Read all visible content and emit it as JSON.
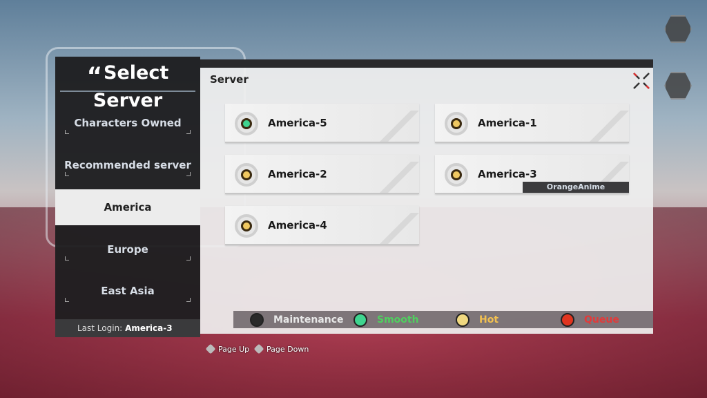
{
  "sidebar": {
    "title": "Select Server",
    "quote": "“",
    "items": [
      {
        "label": "Characters Owned"
      },
      {
        "label": "Recommended server"
      },
      {
        "label": "America",
        "selected": true
      },
      {
        "label": "Europe"
      },
      {
        "label": "East Asia"
      }
    ],
    "last_login_label": "Last Login:",
    "last_login_value": "America-3"
  },
  "main": {
    "header": "Server",
    "servers": [
      {
        "name": "America-5",
        "status": "Smooth",
        "color": "#3fd48f"
      },
      {
        "name": "America-1",
        "status": "Hot",
        "color": "#f0c860"
      },
      {
        "name": "America-2",
        "status": "Hot",
        "color": "#f0c860"
      },
      {
        "name": "America-3",
        "status": "Hot",
        "color": "#f0c860",
        "tag": "OrangeAnime"
      },
      {
        "name": "America-4",
        "status": "Hot",
        "color": "#f0c860"
      }
    ]
  },
  "legend": [
    {
      "label": "Maintenance",
      "color": "#e8e8e8",
      "icon": "#2a2a2a"
    },
    {
      "label": "Smooth",
      "color": "#4fcf5f",
      "icon": "#3fd48f"
    },
    {
      "label": "Hot",
      "color": "#f2c050",
      "icon": "#f0d880"
    },
    {
      "label": "Queue",
      "color": "#e23a3a",
      "icon": "#e0341f"
    }
  ],
  "footer": {
    "page_up": "Page Up",
    "page_down": "Page Down"
  }
}
